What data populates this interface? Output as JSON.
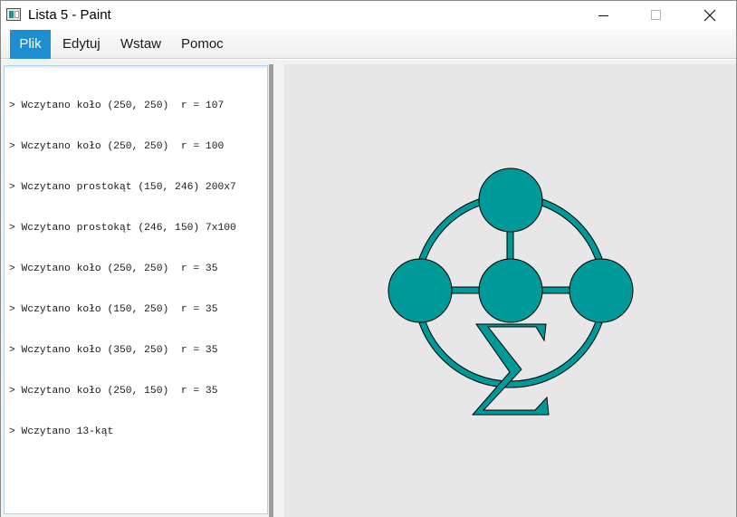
{
  "window": {
    "title": "Lista 5 - Paint",
    "icon": "paint-app-icon",
    "controls": [
      "minimize-icon",
      "maximize-icon",
      "close-icon"
    ]
  },
  "menu": {
    "items": [
      {
        "label": "Plik",
        "active": true
      },
      {
        "label": "Edytuj",
        "active": false
      },
      {
        "label": "Wstaw",
        "active": false
      },
      {
        "label": "Pomoc",
        "active": false
      }
    ],
    "active_color": "#1d8fd1"
  },
  "log": {
    "lines": [
      "> Wczytano koło (250, 250)  r = 107",
      "> Wczytano koło (250, 250)  r = 100",
      "> Wczytano prostokąt (150, 246) 200x7",
      "> Wczytano prostokąt (246, 150) 7x100",
      "> Wczytano koło (250, 250)  r = 35",
      "> Wczytano koło (150, 250)  r = 35",
      "> Wczytano koło (350, 250)  r = 35",
      "> Wczytano koło (250, 150)  r = 35",
      "> Wczytano 13-kąt"
    ]
  },
  "canvas": {
    "background": "#e7e7e7",
    "fill_color": "#009999",
    "stroke_color": "#000000"
  }
}
